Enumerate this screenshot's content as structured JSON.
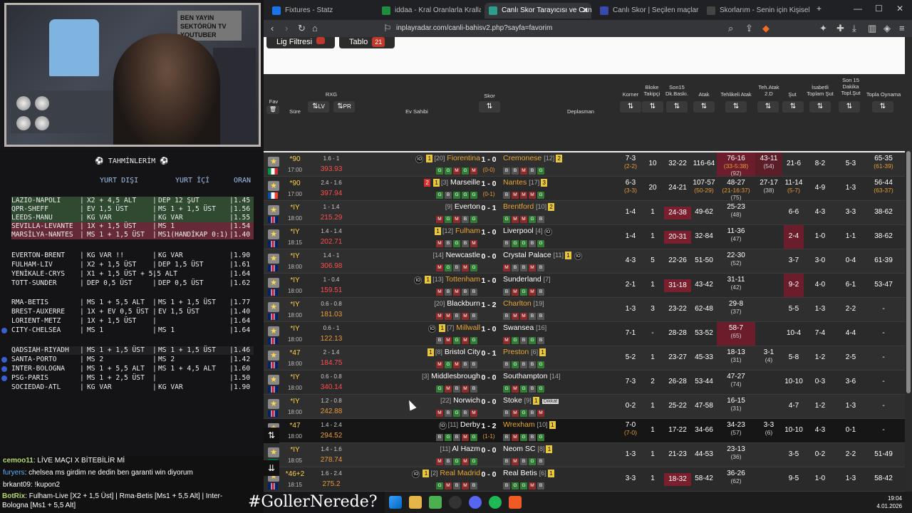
{
  "cam": {
    "sign": "BEN YAYIN SEKTÖRÜN TV YOUTUBER"
  },
  "pred": {
    "title": "⚽   TAHMİNLERİM   ⚽",
    "col1": "YURT DIŞI",
    "col2": "YURT İÇİ",
    "col3": "ORAN",
    "rows": [
      {
        "m": "LAZIO-NAPOLI",
        "a": "X2 + 4,5 ALT",
        "b": "DEP 12 ŞUT",
        "o": "1.45",
        "cls": "green"
      },
      {
        "m": "QPR-SHEFF",
        "a": "EV 1,5 ÜST",
        "b": "MS 1 + 1,5 ÜST",
        "o": "1.56",
        "cls": "green"
      },
      {
        "m": "LEEDS-MANU",
        "a": "KG VAR",
        "b": "KG VAR",
        "o": "1.55",
        "cls": "green"
      },
      {
        "m": "SEVILLA-LEVANTE",
        "a": "1X + 1,5 ÜST",
        "b": "MS 1",
        "o": "1.54",
        "cls": "red"
      },
      {
        "m": "MARSİLYA-NANTES",
        "a": "MS 1 + 1,5 ÜST",
        "b": "MS1(HANDİKAP 0:1)",
        "o": "1.40",
        "cls": "red"
      },
      {
        "m": "EVERTON-BRENT",
        "a": "KG VAR !!",
        "b": "KG VAR",
        "o": "1.90",
        "cls": ""
      },
      {
        "m": "FULHAM-LIV",
        "a": "X2 + 1,5 ÜST",
        "b": "DEP 1,5 ÜST",
        "o": "1.61",
        "cls": ""
      },
      {
        "m": "YENİKALE-CRYS",
        "a": "X1 + 1,5 ÜST + 5,5 ALT",
        "b": "",
        "o": "1.64",
        "cls": ""
      },
      {
        "m": "TOTT-SUNDER",
        "a": "DEP 0,5 ÜST",
        "b": "DEP 0,5 ÜST",
        "o": "1.62",
        "cls": ""
      },
      {
        "m": "RMA-BETIS",
        "a": "MS 1 + 5,5 ALT",
        "b": "MS 1 + 1,5 ÜST",
        "o": "1.77",
        "cls": ""
      },
      {
        "m": "BREST-AUXERRE",
        "a": "1X + EV 0,5 ÜST",
        "b": "EV 1,5 ÜST",
        "o": "1.40",
        "cls": ""
      },
      {
        "m": "LORIENT-METZ",
        "a": "1X + 1,5 ÜST",
        "b": "",
        "o": "1.64",
        "cls": ""
      },
      {
        "m": "CITY-CHELSEA",
        "a": "MS 1",
        "b": "MS 1",
        "o": "1.64",
        "cls": ""
      },
      {
        "m": "QADSIAH-RIYADH",
        "a": "MS 1 + 1,5 ÜST",
        "b": "MS 1 + 1,5 ÜST",
        "o": "1.46",
        "cls": "hl"
      },
      {
        "m": "SANTA-PORTO",
        "a": "MS 2",
        "b": "MS 2",
        "o": "1.42",
        "cls": ""
      },
      {
        "m": "INTER-BOLOGNA",
        "a": "MS 1 + 5,5 ALT",
        "b": "MS 1 + 4,5 ALT",
        "o": "1.60",
        "cls": ""
      },
      {
        "m": "PSG-PARIS",
        "a": "MS 1 + 2,5 ÜST",
        "b": "",
        "o": "1.50",
        "cls": ""
      },
      {
        "m": "SOCIEDAD-ATL",
        "a": "KG VAR",
        "b": "KG VAR",
        "o": "1.90",
        "cls": ""
      }
    ]
  },
  "chat": {
    "l1u": "cemoo11",
    "l1t": ": LİVE MAÇI X BİTEBİLİR Mİ",
    "l2u": "furyers",
    "l2t": ": chelsea ms girdim ne dedin ben garanti win diyorum",
    "l3u": "brkant09",
    "l3t": ": !kupon2",
    "botu": "BotRix",
    "bott": ": Fulham-Live [X2 + 1,5 Üst] | Rma-Betis [Ms1 + 5,5 Alt] | Inter-Bologna [Ms1 + 5,5 Alt]"
  },
  "hashtag": "#GollerNerede?",
  "browser": {
    "tabs": [
      "Fixtures - Statz",
      "iddaa - Kral Oranlarla Krallar Gibi",
      "Canlı Skor Tarayıcısı ve Canlı S",
      "Canlı Skor | Seçilen maçlar için ca",
      "Skorlarım - Senin için Kişiselleştiri"
    ],
    "url": "inplayradar.com/canli-bahisv2.php?sayfa=favorim"
  },
  "filters": {
    "lig": "Lig Filtresi",
    "tablo": "Tablo",
    "tablo_count": "21"
  },
  "headers": {
    "fav": "Fav",
    "sure": "Süre",
    "rxg": "RXG",
    "lv": "LV",
    "pr": "PR",
    "ev": "Ev Sahibi",
    "skor": "Skor",
    "dep": "Deplasman",
    "korner": "Korner",
    "bloke": "Bloke Takipçi",
    "son15": "Son15 Dk.Baskı.",
    "atak": "Atak",
    "tehlikeli": "Tehlikeli Atak",
    "tehatak": "Teh.Atak 2.D",
    "sut": "Şut",
    "isabetli": "İsabetli Toplam Şut",
    "son15sut": "Son 15 Dakika Topl.Şut",
    "topla": "Topla Oynama"
  },
  "matches": [
    {
      "flag": "it",
      "min": "*90",
      "ko": "17:00",
      "rxg": "1.6 - 1",
      "pts": "393.93",
      "pc": "",
      "home": "Fiorentina",
      "hr": "[20]",
      "hy": true,
      "hred": "",
      "hio": true,
      "hf": "GGMGM",
      "score": "1 - 0",
      "hs": "(0-0)",
      "away": "Cremonese",
      "ar": "[12]",
      "ay": "2",
      "aio": false,
      "af": "BBMBG",
      "ady": false,
      "kor": "7-3",
      "kors": "(2-2)",
      "blk": "10",
      "s15": "32-22",
      "s15c": "",
      "atk": "116-64",
      "teh": "76-16",
      "tehs": "(33-5:38)",
      "tehs2": "(92)",
      "tehc": "hot",
      "t2": "43-11",
      "t2s": "(54)",
      "t2c": "hot2",
      "sut": "21-6",
      "sutc": "",
      "isb": "8-2",
      "s15s": "5-3",
      "top": "65-35",
      "tops": "(61-39)",
      "ac": "y"
    },
    {
      "flag": "fr",
      "min": "*90",
      "ko": "17:00",
      "rxg": "2.4 - 1.6",
      "pts": "397.94",
      "pc": "",
      "home": "Marseille",
      "hr": "[3]",
      "hy": true,
      "hred": "2",
      "hio": false,
      "hf": "GBGGG",
      "score": "1 - 0",
      "hs": "(0-1)",
      "away": "Nantes",
      "ar": "[17]",
      "ay": "3",
      "aio": false,
      "af": "BMMMG",
      "ady": false,
      "kor": "6-3",
      "kors": "(3-3)",
      "blk": "20",
      "s15": "24-21",
      "s15c": "",
      "atk": "107-57",
      "atks": "(50-29)",
      "teh": "48-27",
      "tehs": "(21-16:37)",
      "tehs2": "(75)",
      "tehc": "",
      "t2": "27-17",
      "t2s": "(38)",
      "t2c": "",
      "sut": "11-14",
      "suts": "(5-7)",
      "sutc": "",
      "isb": "4-9",
      "s15s": "1-3",
      "top": "56-44",
      "tops": "(63-37)",
      "ac": "y"
    },
    {
      "flag": "",
      "min": "*IY",
      "ko": "18:00",
      "rxg": "1 - 1.4",
      "pts": "215.29",
      "pc": "",
      "home": "Everton",
      "hr": "[9]",
      "hy": false,
      "hred": "",
      "hio": false,
      "hf": "MGMBG",
      "score": "0 - 1",
      "hs": "",
      "away": "Brentford",
      "ar": "[10]",
      "ay": "2",
      "aio": false,
      "af": "GMMGB",
      "ady": false,
      "kor": "1-4",
      "blk": "1",
      "s15": "24-38",
      "s15c": "red",
      "atk": "49-62",
      "teh": "25-23",
      "tehs2": "(48)",
      "tehc": "",
      "t2": "",
      "sut": "6-6",
      "isb": "4-3",
      "s15s": "3-3",
      "top": "38-62",
      "ac": "y"
    },
    {
      "flag": "",
      "min": "*IY",
      "ko": "18:15",
      "rxg": "1.4 - 1.4",
      "pts": "202.71",
      "pc": "",
      "home": "Fulham",
      "hr": "[12]",
      "hy": false,
      "hred": "",
      "hio": false,
      "hf": "MBGBM",
      "score": "1 - 0",
      "hs": "",
      "away": "Liverpool",
      "ar": "[4]",
      "ay": "",
      "aio": true,
      "af": "BGGBG",
      "ady": false,
      "kor": "1-4",
      "blk": "1",
      "s15": "20-31",
      "s15c": "red",
      "atk": "32-84",
      "teh": "11-36",
      "tehs2": "(47)",
      "tehc": "",
      "t2": "",
      "sut": "2-4",
      "sutc": "hotsut",
      "isb": "1-0",
      "s15s": "1-1",
      "top": "38-62",
      "hy2": true
    },
    {
      "flag": "",
      "min": "*IY",
      "ko": "18:00",
      "rxg": "1.4 - 1",
      "pts": "306.98",
      "pc": "",
      "home": "Newcastle",
      "hr": "[14]",
      "hy": false,
      "hred": "",
      "hio": false,
      "hf": "MGBMG",
      "score": "0 - 0",
      "hs": "",
      "away": "Crystal Palace",
      "ar": "[11]",
      "ay": "1",
      "aio": true,
      "af": "MBBMB",
      "ady": false,
      "kor": "4-3",
      "blk": "5",
      "s15": "22-26",
      "s15c": "",
      "atk": "51-50",
      "teh": "22-30",
      "tehs2": "(52)",
      "tehc": "",
      "t2": "",
      "sut": "3-7",
      "isb": "3-0",
      "s15s": "0-4",
      "top": "61-39"
    },
    {
      "flag": "",
      "min": "*IY",
      "ko": "18:00",
      "rxg": "1 - 0.4",
      "pts": "159.51",
      "pc": "",
      "home": "Tottenham",
      "hr": "[13]",
      "hy": false,
      "hred": "",
      "hio": true,
      "hf": "MBMBB",
      "score": "1 - 0",
      "hs": "",
      "away": "Sunderland",
      "ar": "[7]",
      "ay": "",
      "aio": false,
      "af": "BMGMB",
      "ady": false,
      "kor": "2-1",
      "blk": "1",
      "s15": "31-18",
      "s15c": "red",
      "atk": "43-42",
      "teh": "31-11",
      "tehs2": "(42)",
      "tehc": "",
      "t2": "",
      "sut": "9-2",
      "sutc": "hotsut",
      "isb": "4-0",
      "s15s": "6-1",
      "top": "53-47",
      "hy2": true
    },
    {
      "flag": "",
      "min": "*IY",
      "ko": "18:00",
      "rxg": "0.6 - 0.8",
      "pts": "181.03",
      "pc": "ora",
      "home": "Blackburn",
      "hr": "[20]",
      "hy": false,
      "hred": "",
      "hio": false,
      "hf": "MMBMB",
      "score": "1 - 2",
      "hs": "",
      "away": "Charlton",
      "ar": "[19]",
      "ay": "",
      "aio": false,
      "af": "BMMBB",
      "ady": false,
      "kor": "1-3",
      "blk": "3",
      "s15": "23-22",
      "s15c": "",
      "atk": "62-48",
      "teh": "29-8",
      "tehs2": "(37)",
      "tehc": "",
      "t2": "",
      "sut": "5-5",
      "isb": "1-3",
      "s15s": "2-2",
      "top": "-",
      "ac": "y"
    },
    {
      "flag": "",
      "min": "*IY",
      "ko": "18:00",
      "rxg": "0.6 - 1",
      "pts": "122.13",
      "pc": "ora",
      "home": "Millwall",
      "hr": "[7]",
      "hy": false,
      "hred": "",
      "hio": true,
      "hf": "BMGMG",
      "score": "1 - 0",
      "hs": "",
      "away": "Swansea",
      "ar": "[16]",
      "ay": "",
      "aio": false,
      "af": "MGBGB",
      "ady": false,
      "kor": "7-1",
      "blk": "-",
      "s15": "28-28",
      "s15c": "",
      "atk": "53-52",
      "teh": "58-7",
      "tehs2": "(65)",
      "tehc": "hot",
      "t2": "",
      "sut": "10-4",
      "isb": "7-4",
      "s15s": "4-4",
      "top": "-",
      "hy2": true
    },
    {
      "flag": "",
      "min": "*47",
      "ko": "18:00",
      "rxg": "2 - 1.4",
      "pts": "184.75",
      "pc": "",
      "home": "Bristol City",
      "hr": "[8]",
      "hy": true,
      "hred": "",
      "hio": false,
      "hf": "MGMBB",
      "score": "0 - 1",
      "hs": "",
      "away": "Preston",
      "ar": "[6]",
      "ay": "1",
      "aio": false,
      "af": "BGBBG",
      "ady": false,
      "kor": "5-2",
      "blk": "1",
      "s15": "23-27",
      "s15c": "",
      "atk": "45-33",
      "teh": "18-13",
      "tehs2": "(31)",
      "tehc": "",
      "t2": "3-1",
      "t2s": "(4)",
      "sut": "5-8",
      "isb": "1-2",
      "s15s": "2-5",
      "top": "-",
      "ac": "y"
    },
    {
      "flag": "",
      "min": "*IY",
      "ko": "18:00",
      "rxg": "0.6 - 0.8",
      "pts": "340.14",
      "pc": "",
      "home": "Middlesbrough",
      "hr": "[3]",
      "hy": false,
      "hred": "",
      "hio": false,
      "hf": "GMBMB",
      "score": "0 - 0",
      "hs": "",
      "away": "Southampton",
      "ar": "[14]",
      "ay": "",
      "aio": false,
      "af": "GMGBG",
      "ady": false,
      "kor": "7-3",
      "blk": "2",
      "s15": "26-28",
      "s15c": "",
      "atk": "53-44",
      "teh": "47-27",
      "tehs2": "(74)",
      "tehc": "",
      "t2": "",
      "sut": "10-10",
      "isb": "0-3",
      "s15s": "3-6",
      "top": "-"
    },
    {
      "flag": "",
      "min": "*IY",
      "ko": "18:00",
      "rxg": "1.2 - 0.8",
      "pts": "242.88",
      "pc": "ora",
      "home": "Norwich",
      "hr": "[22]",
      "hy": false,
      "hred": "",
      "hio": false,
      "hf": "MBGBM",
      "score": "0 - 0",
      "hs": "",
      "away": "Stoke",
      "ar": "[9]",
      "ay": "1",
      "aio": false,
      "af": "BMGBM",
      "ady": true,
      "kor": "0-2",
      "blk": "1",
      "s15": "25-22",
      "s15c": "",
      "atk": "47-58",
      "teh": "16-15",
      "tehs2": "(31)",
      "tehc": "",
      "t2": "",
      "sut": "4-7",
      "isb": "1-2",
      "s15s": "1-3",
      "top": "-"
    },
    {
      "flag": "",
      "min": "*47",
      "ko": "18:00",
      "rxg": "1.4 - 2.4",
      "pts": "294.52",
      "pc": "ora",
      "home": "Derby",
      "hr": "[11]",
      "hy": false,
      "hred": "",
      "hio": true,
      "hf": "BGBMG",
      "score": "1 - 2",
      "hs": "(1-1)",
      "away": "Wrexham",
      "ar": "[10]",
      "ay": "1",
      "aio": false,
      "af": "BMGBG",
      "ady": false,
      "kor": "7-0",
      "kors": "(7-0)",
      "blk": "1",
      "s15": "17-22",
      "s15c": "",
      "atk": "34-66",
      "teh": "34-23",
      "tehs2": "(57)",
      "tehc": "",
      "t2": "3-3",
      "t2s": "(6)",
      "sut": "10-10",
      "isb": "4-3",
      "s15s": "0-1",
      "top": "-",
      "dark": true,
      "ac": "y"
    },
    {
      "flag": "sa",
      "min": "*IY",
      "ko": "18:05",
      "rxg": "1.4 - 1.6",
      "pts": "278.74",
      "pc": "ora",
      "home": "Al Hazm",
      "hr": "[11]",
      "hy": false,
      "hred": "",
      "hio": false,
      "hf": "MBGMG",
      "score": "0 - 0",
      "hs": "",
      "away": "Neom SC",
      "ar": "[8]",
      "ay": "1",
      "aio": false,
      "af": "BMBGB",
      "ady": false,
      "kor": "1-3",
      "blk": "1",
      "s15": "21-23",
      "s15c": "",
      "atk": "44-53",
      "teh": "23-13",
      "tehs2": "(36)",
      "tehc": "",
      "t2": "",
      "sut": "3-5",
      "isb": "0-2",
      "s15s": "2-2",
      "top": "51-49"
    },
    {
      "flag": "",
      "min": "*46+2",
      "ko": "18:15",
      "rxg": "1.6 - 2.4",
      "pts": "275.2",
      "pc": "ora",
      "home": "Real Madrid",
      "hr": "[2]",
      "hy": false,
      "hred": "",
      "hio": true,
      "hf": "GMBMB",
      "score": "0 - 0",
      "hs": "",
      "away": "Real Betis",
      "ar": "[6]",
      "ay": "1",
      "aio": false,
      "af": "BGGMB",
      "ady": false,
      "kor": "3-3",
      "blk": "1",
      "s15": "18-32",
      "s15c": "red",
      "atk": "58-42",
      "teh": "36-26",
      "tehs2": "(62)",
      "tehc": "",
      "t2": "",
      "sut": "9-5",
      "isb": "1-0",
      "s15s": "1-3",
      "top": "58-42",
      "hy2": true
    },
    {
      "flag": "",
      "min": "*32",
      "ko": "18:00",
      "rxg": "1 - 0.8",
      "pts": "",
      "pc": "",
      "home": "Rio Ave",
      "hr": "[11]",
      "hy": false,
      "hred": "",
      "hio": false,
      "hf": "",
      "score": "0 - 0",
      "hs": "",
      "away": "Casa Pia",
      "ar": "[15]",
      "ay": "",
      "aio": true,
      "af": "",
      "ady": true,
      "kor": "",
      "blk": "",
      "s15": "",
      "atk": "",
      "teh": "11-16",
      "tehs2": "",
      "t2": "",
      "sut": "",
      "isb": "",
      "s15s": "",
      "top": ""
    }
  ],
  "dikkat": "Dikkat",
  "tray": {
    "time": "19:04",
    "date": "4.01.2026"
  }
}
